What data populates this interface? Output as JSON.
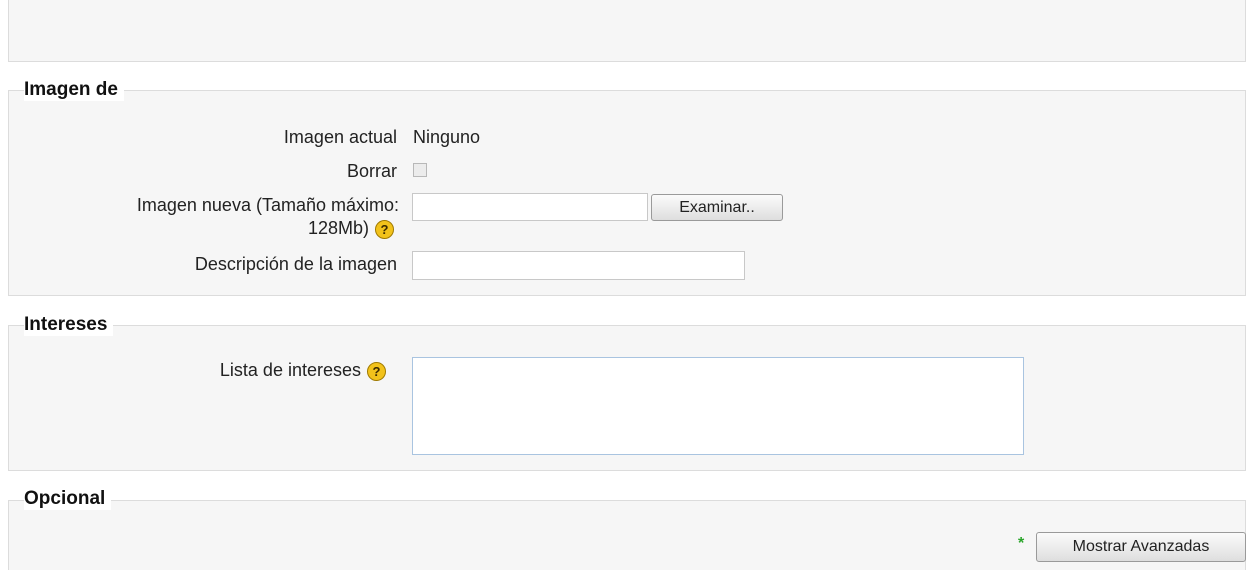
{
  "sections": {
    "imagen": {
      "legend": "Imagen de",
      "current_image_label": "Imagen actual",
      "current_image_value": "Ninguno",
      "delete_label": "Borrar",
      "delete_checked": false,
      "new_image_label_line1": "Imagen nueva (Tamaño máximo:",
      "new_image_label_line2": "128Mb)",
      "file_value": "",
      "browse_button": "Examinar..",
      "description_label": "Descripción de la imagen",
      "description_value": ""
    },
    "intereses": {
      "legend": "Intereses",
      "list_label": "Lista de intereses",
      "list_value": ""
    },
    "opcional": {
      "legend": "Opcional",
      "required_marker": "*",
      "show_advanced_button": "Mostrar Avanzadas"
    }
  },
  "icons": {
    "help_glyph": "?"
  },
  "colors": {
    "help_icon": "#f2c21b",
    "required_marker": "#2aa52a",
    "fieldset_background": "#f6f6f6"
  }
}
